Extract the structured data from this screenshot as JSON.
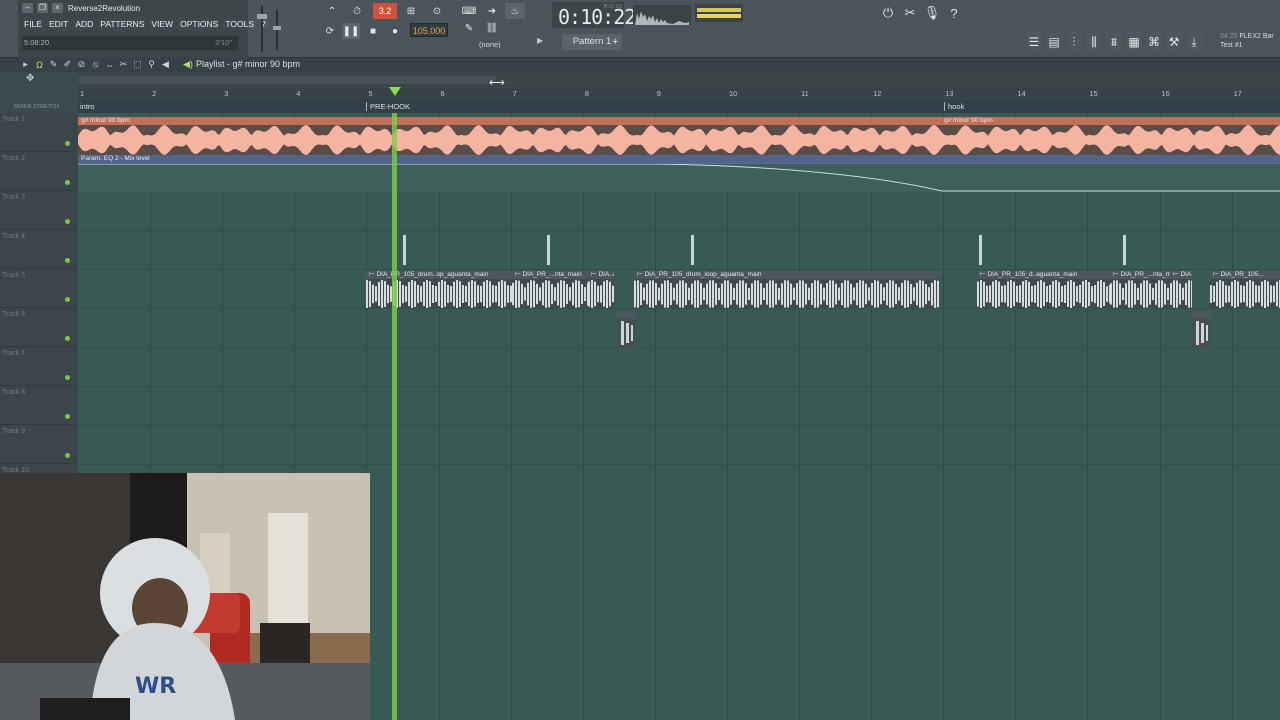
{
  "window": {
    "project_title": "Reverse2Revolution",
    "menu": [
      "FILE",
      "EDIT",
      "ADD",
      "PATTERNS",
      "VIEW",
      "OPTIONS",
      "TOOLS",
      "?"
    ],
    "hint_left": "5:08:20",
    "hint_right": "0'10\""
  },
  "transport": {
    "tempo": "105.000",
    "time": "0:10:22",
    "time_unit": "M:S:CS",
    "pattern": "Pattern 1",
    "arrangement": "(none)"
  },
  "plugin_info": {
    "line1": "04:20",
    "line2": "FLEX2 Bar",
    "line3": "Test #1"
  },
  "playlist": {
    "title": "Playlist - g# minor 90 bpm",
    "bars": [
      "1",
      "2",
      "3",
      "4",
      "5",
      "6",
      "7",
      "8",
      "9",
      "10",
      "11",
      "12",
      "13",
      "14",
      "15",
      "16",
      "17"
    ],
    "markers": [
      "intro",
      "PRE-HOOK",
      "hook"
    ],
    "header_label": "MIXER  STRETCH",
    "tracks": [
      "Track 1",
      "Track 2",
      "Track 3",
      "Track 4",
      "Track 5",
      "Track 6",
      "Track 7",
      "Track 8",
      "Track 9",
      "Track 10"
    ],
    "clips": {
      "track1_left": "g# minor 90 bpm",
      "track1_right": "g# minor 90 bpm",
      "track2": "Param. EQ 2 - Mix level",
      "track5": [
        "DIA_PR_105_drum..op_aguanta_main",
        "DIA_PR_...nta_main",
        "DIA..ain",
        "DIA_PR_105_drum_loop_aguanta_main",
        "DIA_PR_105_d..aguanta_main",
        "DIA_PR_...nta_main",
        "DIA..ain",
        "DIA_PR_105..."
      ]
    }
  },
  "colors": {
    "accent_playhead": "#79d146",
    "clip_audio": "#c07058",
    "automation": "#526588",
    "grid": "#385a55"
  }
}
